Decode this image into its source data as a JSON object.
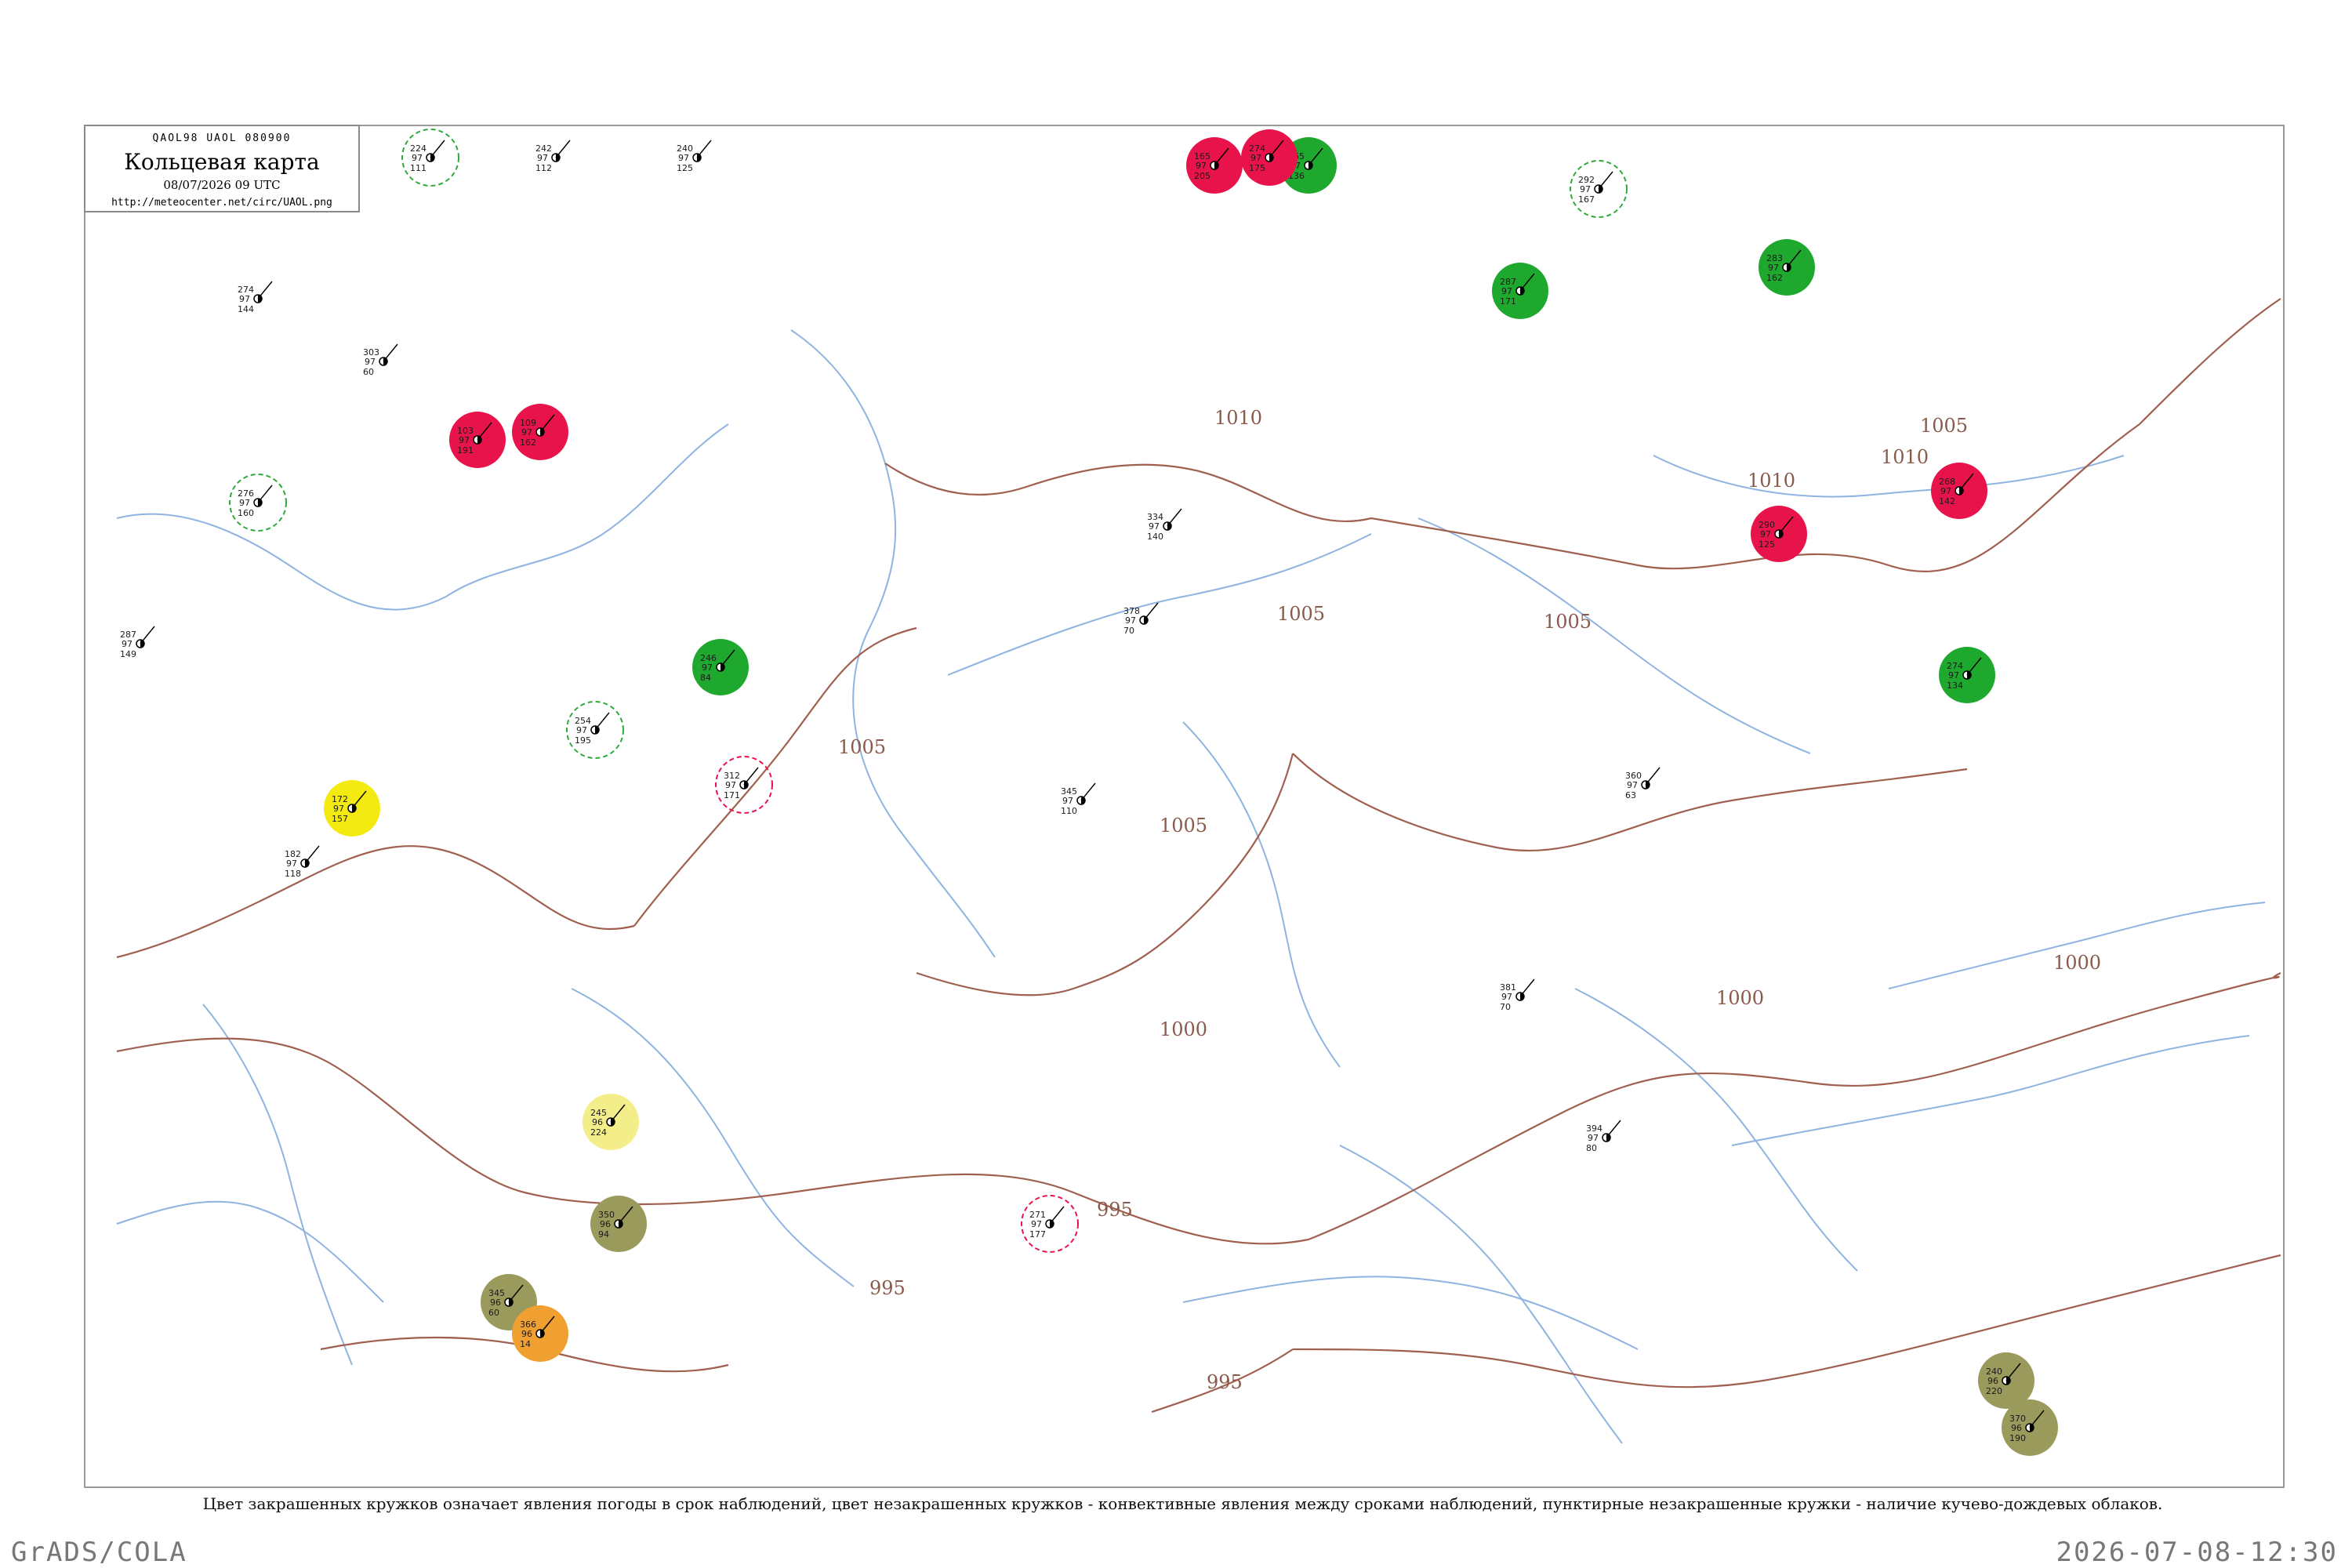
{
  "header": {
    "map_id": "QAOL98  UAOL  080900",
    "title": "Кольцевая карта",
    "time": "08/07/2026 09 UTC",
    "url": "http://meteocenter.net/circ/UAOL.png"
  },
  "caption": "Цвет закрашенных кружков означает явления погоды в срок наблюдений, цвет незакрашенных кружков - конвективные явления между сроками наблюдений, пунктирные незакрашенные кружки - наличие кучево-дождевых облаков.",
  "footer": {
    "brand": "GrADS/COLA",
    "timestamp": "2026-07-08-12:30"
  },
  "colors": {
    "isobar": "#a0604f",
    "river": "#8fb4e0",
    "thunder": "#e8134a",
    "rain": "#1fa82e",
    "cb_ring": "#2faa3a",
    "fog": "#f2ea10",
    "dust": "#9a9a5c",
    "haze": "#f0a030",
    "mist": "#f4ee8a"
  },
  "isobars": [
    {
      "label": "1010",
      "kind": "isobar"
    },
    {
      "label": "1010",
      "kind": "isobar"
    },
    {
      "label": "1010",
      "kind": "isobar"
    },
    {
      "label": "1005",
      "kind": "isobar"
    },
    {
      "label": "1005",
      "kind": "isobar"
    },
    {
      "label": "1005",
      "kind": "isobar"
    },
    {
      "label": "1005",
      "kind": "isobar"
    },
    {
      "label": "1005",
      "kind": "isobar"
    },
    {
      "label": "1000",
      "kind": "isobar"
    },
    {
      "label": "1000",
      "kind": "isobar"
    },
    {
      "label": "1000",
      "kind": "isobar"
    },
    {
      "label": "995",
      "kind": "isobar"
    },
    {
      "label": "995",
      "kind": "isobar"
    },
    {
      "label": "995",
      "kind": "isobar"
    }
  ],
  "stations": [
    {
      "code": "224",
      "temp": "97",
      "dew": "111",
      "phenomenon": "cb"
    },
    {
      "code": "242",
      "temp": "97",
      "dew": "112",
      "phenomenon": "none"
    },
    {
      "code": "240",
      "temp": "97",
      "dew": "125",
      "phenomenon": "none"
    },
    {
      "code": "265",
      "temp": "97",
      "dew": "136",
      "phenomenon": "rain"
    },
    {
      "code": "165",
      "temp": "97",
      "dew": "205",
      "phenomenon": "thunder"
    },
    {
      "code": "274",
      "temp": "97",
      "dew": "144",
      "phenomenon": "none"
    },
    {
      "code": "303",
      "temp": "97",
      "dew": "60",
      "phenomenon": "none"
    },
    {
      "code": "103",
      "temp": "97",
      "dew": "191",
      "phenomenon": "thunder"
    },
    {
      "code": "109",
      "temp": "97",
      "dew": "162",
      "phenomenon": "thunder"
    },
    {
      "code": "276",
      "temp": "97",
      "dew": "160",
      "phenomenon": "cb"
    },
    {
      "code": "287",
      "temp": "97",
      "dew": "149",
      "phenomenon": "none"
    },
    {
      "code": "172",
      "temp": "97",
      "dew": "157",
      "phenomenon": "fog"
    },
    {
      "code": "182",
      "temp": "97",
      "dew": "118",
      "phenomenon": "none"
    },
    {
      "code": "254",
      "temp": "97",
      "dew": "195",
      "phenomenon": "cb"
    },
    {
      "code": "246",
      "temp": "97",
      "dew": "84",
      "phenomenon": "rain"
    },
    {
      "code": "312",
      "temp": "97",
      "dew": "171",
      "phenomenon": "thunder-ring"
    },
    {
      "code": "245",
      "temp": "96",
      "dew": "224",
      "phenomenon": "mist"
    },
    {
      "code": "350",
      "temp": "96",
      "dew": "94",
      "phenomenon": "dust"
    },
    {
      "code": "345",
      "temp": "96",
      "dew": "60",
      "phenomenon": "dust"
    },
    {
      "code": "366",
      "temp": "96",
      "dew": "14",
      "phenomenon": "haze"
    },
    {
      "code": "287",
      "temp": "97",
      "dew": "171",
      "phenomenon": "rain"
    },
    {
      "code": "274",
      "temp": "97",
      "dew": "175",
      "phenomenon": "thunder"
    },
    {
      "code": "283",
      "temp": "97",
      "dew": "162",
      "phenomenon": "rain"
    },
    {
      "code": "292",
      "temp": "97",
      "dew": "167",
      "phenomenon": "cb"
    },
    {
      "code": "268",
      "temp": "97",
      "dew": "142",
      "phenomenon": "thunder"
    },
    {
      "code": "290",
      "temp": "97",
      "dew": "125",
      "phenomenon": "thunder"
    },
    {
      "code": "274",
      "temp": "97",
      "dew": "134",
      "phenomenon": "rain"
    },
    {
      "code": "271",
      "temp": "97",
      "dew": "177",
      "phenomenon": "thunder-ring"
    },
    {
      "code": "240",
      "temp": "96",
      "dew": "220",
      "phenomenon": "dust"
    },
    {
      "code": "370",
      "temp": "96",
      "dew": "190",
      "phenomenon": "dust"
    },
    {
      "code": "381",
      "temp": "97",
      "dew": "70",
      "phenomenon": "none"
    },
    {
      "code": "394",
      "temp": "97",
      "dew": "80",
      "phenomenon": "none"
    },
    {
      "code": "345",
      "temp": "97",
      "dew": "110",
      "phenomenon": "none"
    },
    {
      "code": "334",
      "temp": "97",
      "dew": "140",
      "phenomenon": "none"
    },
    {
      "code": "378",
      "temp": "97",
      "dew": "70",
      "phenomenon": "none"
    },
    {
      "code": "360",
      "temp": "97",
      "dew": "63",
      "phenomenon": "none"
    }
  ]
}
